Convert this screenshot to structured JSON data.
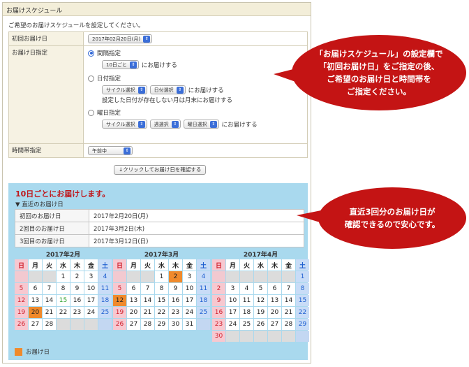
{
  "panel": {
    "title": "お届けスケジュール",
    "intro": "ご希望のお届けスケジュールを設定してください。"
  },
  "form": {
    "first_delivery": {
      "label": "初回お届け日",
      "value": "2017年02月20日(月)"
    },
    "delivery_spec": {
      "label": "お届け日指定",
      "interval": {
        "label": "間隔指定",
        "selected": true,
        "select": "10日ごと",
        "suffix": "にお届けする"
      },
      "date": {
        "label": "日付指定",
        "selected": false,
        "cycle": "サイクル選択",
        "day": "日付選択",
        "suffix": "にお届けする",
        "note": "設定した日付が存在しない月は月末にお届けする"
      },
      "weekday": {
        "label": "曜日指定",
        "selected": false,
        "cycle": "サイクル選択",
        "week": "週選択",
        "dow": "曜日選択",
        "suffix": "にお届けする"
      }
    },
    "time_slot": {
      "label": "時間帯指定",
      "value": "午前中"
    }
  },
  "confirm_button": "↓クリックしてお届け日を確認する",
  "schedule": {
    "headline": "10日ごとにお届けします。",
    "recent_title": "▼ 直近のお届け日",
    "rows": [
      {
        "key": "初回のお届け日",
        "value": "2017年2月20日(月)"
      },
      {
        "key": "2回目のお届け日",
        "value": "2017年3月2日(木)"
      },
      {
        "key": "3回目のお届け日",
        "value": "2017年3月12日(日)"
      }
    ],
    "weekdays": [
      "日",
      "月",
      "火",
      "水",
      "木",
      "金",
      "土"
    ],
    "calendars": [
      {
        "title": "2017年2月",
        "first_dow": 3,
        "days": 28,
        "delivery": [
          20
        ],
        "holidays": [
          15
        ]
      },
      {
        "title": "2017年3月",
        "first_dow": 3,
        "days": 31,
        "delivery": [
          2,
          12
        ],
        "holidays": []
      },
      {
        "title": "2017年4月",
        "first_dow": 6,
        "days": 30,
        "delivery": [],
        "holidays": []
      }
    ],
    "legend": "お届け日"
  },
  "callouts": {
    "top": [
      "「お届けスケジュール」の設定欄で",
      "「初回お届け日」をご指定の後、",
      "ご希望のお届け日と時間帯を",
      "ご指定ください。"
    ],
    "bottom": [
      "直近3回分のお届け日が",
      "確認できるので安心です。"
    ]
  },
  "colors": {
    "callout": "#c41414",
    "delivery": "#f08a2c",
    "schedule_bg": "#a9d9ee",
    "headline": "#c0181c"
  }
}
